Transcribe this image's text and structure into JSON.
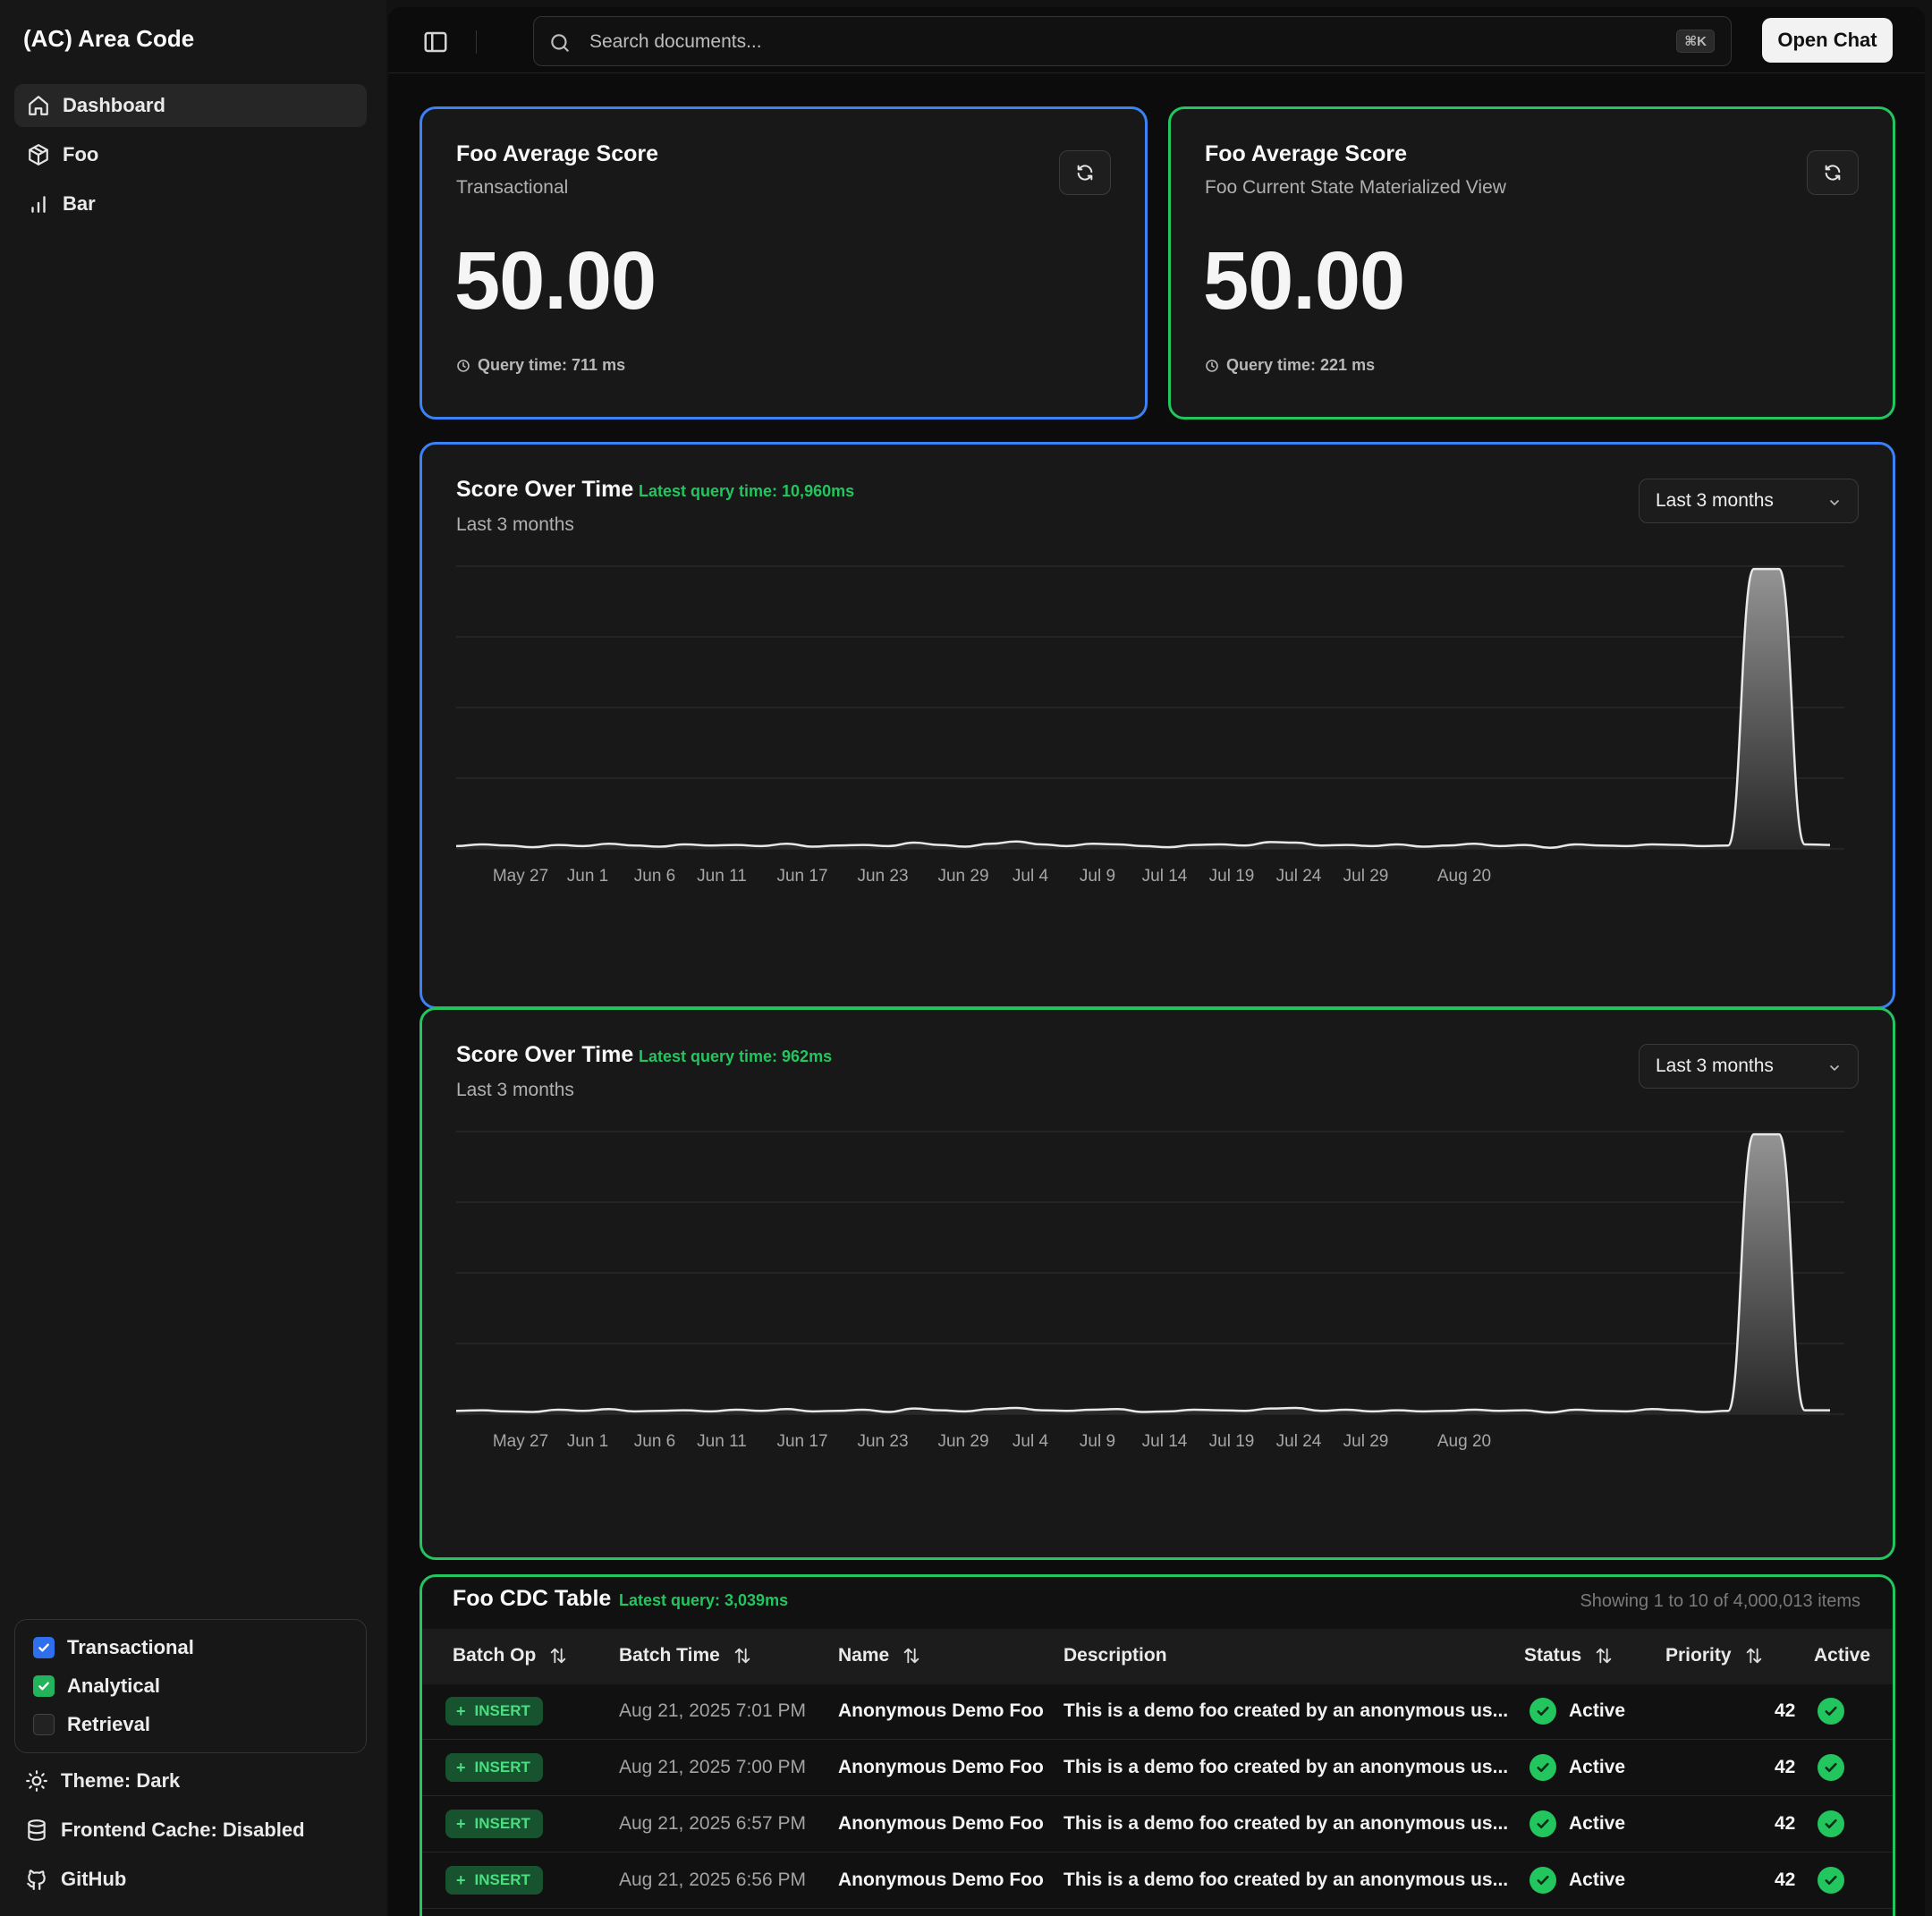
{
  "sidebar": {
    "brand": "(AC) Area Code",
    "nav": [
      {
        "label": "Dashboard",
        "icon": "home-icon",
        "active": true
      },
      {
        "label": "Foo",
        "icon": "package-icon",
        "active": false
      },
      {
        "label": "Bar",
        "icon": "bar-chart-icon",
        "active": false
      }
    ],
    "toggles": [
      {
        "label": "Transactional",
        "checked": true,
        "color": "#2f6fed"
      },
      {
        "label": "Analytical",
        "checked": true,
        "color": "#22b35c"
      },
      {
        "label": "Retrieval",
        "checked": false
      }
    ],
    "footer": [
      {
        "label": "Theme: Dark",
        "icon": "sun-icon"
      },
      {
        "label": "Frontend Cache: Disabled",
        "icon": "database-icon"
      },
      {
        "label": "GitHub",
        "icon": "github-icon"
      }
    ]
  },
  "topbar": {
    "search_placeholder": "Search documents...",
    "shortcut": "⌘K",
    "open_chat": "Open Chat"
  },
  "score_cards": [
    {
      "title": "Foo Average Score",
      "subtitle": "Transactional",
      "value": "50.00",
      "query_time": "Query time: 711 ms",
      "accent": "#3b82f6"
    },
    {
      "title": "Foo Average Score",
      "subtitle": "Foo Current State Materialized View",
      "value": "50.00",
      "query_time": "Query time: 221 ms",
      "accent": "#22c55e"
    }
  ],
  "charts": [
    {
      "title": "Score Over Time",
      "query_time": "Latest query time: 10,960ms",
      "subtitle": "Last 3 months",
      "range": "Last 3 months",
      "accent": "#3b82f6"
    },
    {
      "title": "Score Over Time",
      "query_time": "Latest query time: 962ms",
      "subtitle": "Last 3 months",
      "range": "Last 3 months",
      "accent": "#22c55e"
    }
  ],
  "chart_data": [
    {
      "type": "area",
      "title": "Score Over Time",
      "x_ticks": [
        "May 27",
        "Jun 1",
        "Jun 6",
        "Jun 11",
        "Jun 17",
        "Jun 23",
        "Jun 29",
        "Jul 4",
        "Jul 9",
        "Jul 14",
        "Jul 19",
        "Jul 24",
        "Jul 29",
        "Aug 20"
      ],
      "ylim": [
        0,
        50
      ],
      "grid": true,
      "series": [
        {
          "values": [
            0.5,
            0.8,
            0.6,
            0.3,
            0.7,
            0.5,
            0.9,
            0.6,
            0.4,
            0.8,
            0.6,
            0.7,
            0.5,
            0.9,
            0.4,
            0.6,
            0.7,
            0.5,
            1.1,
            0.7,
            0.4,
            0.9,
            1.3,
            0.8,
            0.5,
            0.9,
            0.8,
            0.5,
            0.3,
            0.7,
            0.8,
            0.6,
            1.2,
            1.1,
            0.6,
            0.7,
            0.5,
            0.8,
            0.4,
            0.6,
            0.9,
            0.5,
            0.7,
            0.2,
            0.8,
            0.6,
            0.5,
            0.8,
            0.7,
            0.5,
            0.6,
            49.5,
            49.5,
            0.8,
            0.7
          ]
        }
      ]
    },
    {
      "type": "area",
      "title": "Score Over Time",
      "x_ticks": [
        "May 27",
        "Jun 1",
        "Jun 6",
        "Jun 11",
        "Jun 17",
        "Jun 23",
        "Jun 29",
        "Jul 4",
        "Jul 9",
        "Jul 14",
        "Jul 19",
        "Jul 24",
        "Jul 29",
        "Aug 20"
      ],
      "ylim": [
        0,
        50
      ],
      "grid": true,
      "series": [
        {
          "values": [
            0.6,
            0.7,
            0.5,
            0.4,
            0.8,
            0.6,
            0.9,
            0.5,
            0.6,
            0.7,
            0.5,
            0.8,
            0.6,
            0.9,
            0.5,
            0.6,
            0.8,
            0.4,
            1.0,
            0.7,
            0.5,
            0.9,
            1.1,
            0.7,
            0.6,
            0.8,
            0.9,
            0.4,
            0.5,
            0.8,
            0.7,
            0.6,
            1.0,
            1.1,
            0.6,
            0.8,
            0.5,
            0.7,
            0.5,
            0.6,
            0.8,
            0.6,
            0.7,
            0.3,
            0.8,
            0.6,
            0.5,
            0.9,
            0.7,
            0.4,
            0.6,
            49.5,
            49.5,
            0.7,
            0.7
          ]
        }
      ]
    }
  ],
  "table": {
    "title": "Foo CDC Table",
    "query_time": "Latest query: 3,039ms",
    "count": "Showing 1 to 10 of 4,000,013 items",
    "columns": [
      "Batch Op",
      "Batch Time",
      "Name",
      "Description",
      "Status",
      "Priority",
      "Active"
    ],
    "rows": [
      {
        "op": "INSERT",
        "time": "Aug 21, 2025 7:01 PM",
        "name": "Anonymous Demo Foo",
        "desc": "This is a demo foo created by an anonymous us...",
        "status": "Active",
        "priority": "42"
      },
      {
        "op": "INSERT",
        "time": "Aug 21, 2025 7:00 PM",
        "name": "Anonymous Demo Foo",
        "desc": "This is a demo foo created by an anonymous us...",
        "status": "Active",
        "priority": "42"
      },
      {
        "op": "INSERT",
        "time": "Aug 21, 2025 6:57 PM",
        "name": "Anonymous Demo Foo",
        "desc": "This is a demo foo created by an anonymous us...",
        "status": "Active",
        "priority": "42"
      },
      {
        "op": "INSERT",
        "time": "Aug 21, 2025 6:56 PM",
        "name": "Anonymous Demo Foo",
        "desc": "This is a demo foo created by an anonymous us...",
        "status": "Active",
        "priority": "42"
      }
    ]
  }
}
